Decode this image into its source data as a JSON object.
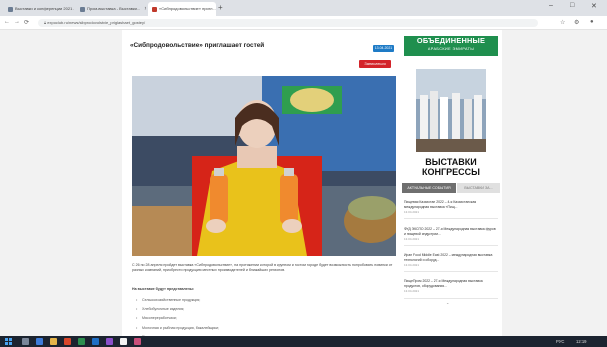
{
  "browser": {
    "tabs": [
      {
        "label": "Выставки и конференции 2021 - В..."
      },
      {
        "label": "Пром-выставка - Выставки..."
      },
      {
        "label": "«Сибпродовольствие» пригл..."
      }
    ],
    "new_tab": "+",
    "url": "expoclub.ru/news/sibprodovolstvie_priglashaet_gostey/",
    "window_controls": [
      "–",
      "□",
      "✕"
    ]
  },
  "article": {
    "title": "«Сибпродовольствие» приглашает гостей",
    "date_badge": "13.04.2021",
    "action_button": "Записаться",
    "body": "С 26 по 28 апреля пройдет выставка «Сибпродовольствие», на протяжении которой в крупном и гостом городе будет возможность попробовать новинки от разных компаний, приобрести продукцию местных производителей и ближайших регионов.",
    "list_intro": "На выставке будут представлены:",
    "list_items": [
      "Сельскохозяйственные продукция;",
      "Хлебобулочные изделия;",
      "Мясопереработчики;",
      "Молочная и рыбная продукция, бакалейщики;",
      "Продукты пчеловодства;"
    ]
  },
  "sidebar": {
    "ad": {
      "heading1": "ОБЪЕДИНЕННЫЕ",
      "heading2": "АРАБСКИЕ ЭМИРАТЫ",
      "title1": "ВЫСТАВКИ",
      "title2": "КОНГРЕССЫ"
    },
    "tabs": [
      "АКТУАЛЬНЫЕ СОБЫТИЯ",
      "ВЫСТАВКИ ЗА..."
    ],
    "news": [
      {
        "title": "Пищевая Казахстан 2022 – 4-я Казахстанская международная выставка «Пищ...",
        "date": "13.04.2021"
      },
      {
        "title": "ФУД ЭКСПО 2022 – 27-я Международная выставка фуров и пищевой индустрии...",
        "date": "13.04.2021"
      },
      {
        "title": "Иран Food Middle East 2022 – международная выставка технологий и оборуд...",
        "date": "13.04.2021"
      },
      {
        "title": "ПищеПром 2022 – 27-я Международная выставка продуктов, оборудования...",
        "date": "13.04.2021"
      }
    ],
    "more": "⌄"
  },
  "taskbar": {
    "clock": "12:19",
    "lang": "РУС"
  },
  "colors": {
    "accent_blue": "#1e7bc6",
    "action_red": "#d3232a",
    "ad_green": "#1f8f4e"
  }
}
